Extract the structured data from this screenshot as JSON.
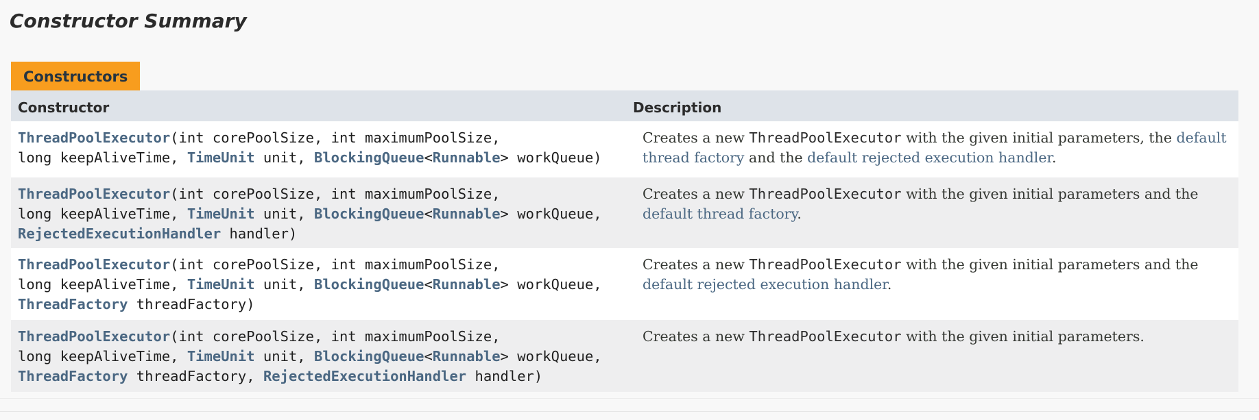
{
  "section": {
    "title": "Constructor Summary",
    "caption": "Constructors"
  },
  "table": {
    "headers": {
      "constructor": "Constructor",
      "description": "Description"
    },
    "rows": [
      {
        "line1": {
          "ctor": "ThreadPoolExecutor",
          "params": "(int corePoolSize, int maximumPoolSize,"
        },
        "line2": {
          "t1": "long keepAliveTime, ",
          "timeunit": "TimeUnit",
          "t2": " unit, ",
          "bq": "BlockingQueue",
          "lt": "<",
          "runnable": "Runnable",
          "t3": "> workQueue)"
        },
        "desc": {
          "p1": "Creates a new ",
          "code": "ThreadPoolExecutor",
          "p2": " with the given initial parameters, the ",
          "link1": "default thread factory",
          "p3": " and the ",
          "link2": "default rejected execution handler",
          "p4": "."
        }
      },
      {
        "line1": {
          "ctor": "ThreadPoolExecutor",
          "params": "(int corePoolSize, int maximumPoolSize,"
        },
        "line2": {
          "t1": "long keepAliveTime, ",
          "timeunit": "TimeUnit",
          "t2": " unit, ",
          "bq": "BlockingQueue",
          "lt": "<",
          "runnable": "Runnable",
          "t3": "> workQueue,"
        },
        "line3": {
          "type1": "RejectedExecutionHandler",
          "t1": " handler)"
        },
        "desc": {
          "p1": "Creates a new ",
          "code": "ThreadPoolExecutor",
          "p2": " with the given initial parameters and the ",
          "link1": "default thread factory",
          "p3": "."
        }
      },
      {
        "line1": {
          "ctor": "ThreadPoolExecutor",
          "params": "(int corePoolSize, int maximumPoolSize,"
        },
        "line2": {
          "t1": "long keepAliveTime, ",
          "timeunit": "TimeUnit",
          "t2": " unit, ",
          "bq": "BlockingQueue",
          "lt": "<",
          "runnable": "Runnable",
          "t3": "> workQueue,"
        },
        "line3": {
          "type1": "ThreadFactory",
          "t1": " threadFactory)"
        },
        "desc": {
          "p1": "Creates a new ",
          "code": "ThreadPoolExecutor",
          "p2": " with the given initial parameters and the ",
          "link1": "default rejected execution handler",
          "p3": "."
        }
      },
      {
        "line1": {
          "ctor": "ThreadPoolExecutor",
          "params": "(int corePoolSize, int maximumPoolSize,"
        },
        "line2": {
          "t1": "long keepAliveTime, ",
          "timeunit": "TimeUnit",
          "t2": " unit, ",
          "bq": "BlockingQueue",
          "lt": "<",
          "runnable": "Runnable",
          "t3": "> workQueue,"
        },
        "line3": {
          "type1": "ThreadFactory",
          "t1": " threadFactory, ",
          "type2": "RejectedExecutionHandler",
          "t2": " handler)"
        },
        "desc": {
          "p1": "Creates a new ",
          "code": "ThreadPoolExecutor",
          "p2": " with the given initial parameters."
        }
      }
    ]
  },
  "colors": {
    "caption_bg": "#f89d1e",
    "header_bg": "#dee3e9",
    "link": "#4a6782",
    "row_alt": "#eeeeef"
  }
}
